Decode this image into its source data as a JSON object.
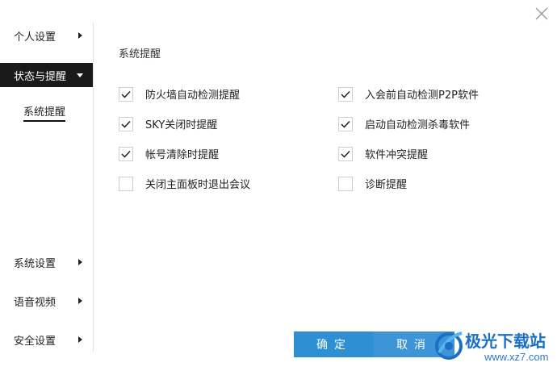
{
  "sidebar": {
    "items": [
      {
        "label": "个人设置"
      },
      {
        "label": "状态与提醒"
      },
      {
        "label": "系统设置"
      },
      {
        "label": "语音视频"
      },
      {
        "label": "安全设置"
      }
    ],
    "sub_item": "系统提醒"
  },
  "main": {
    "section_title": "系统提醒",
    "options": [
      {
        "label": "防火墙自动检测提醒",
        "checked": true
      },
      {
        "label": "入会前自动检测P2P软件",
        "checked": true
      },
      {
        "label": "SKY关闭时提醒",
        "checked": true
      },
      {
        "label": "启动自动检测杀毒软件",
        "checked": true
      },
      {
        "label": "帐号清除时提醒",
        "checked": true
      },
      {
        "label": "软件冲突提醒",
        "checked": true
      },
      {
        "label": "关闭主面板时退出会议",
        "checked": false
      },
      {
        "label": "诊断提醒",
        "checked": false
      }
    ]
  },
  "buttons": {
    "ok": "确定",
    "cancel": "取消"
  },
  "watermark": {
    "title": "极光下载站",
    "url": "www.xz7.com"
  },
  "colors": {
    "primary_button": "#2e8fd2",
    "active_nav": "#1a1a1a"
  }
}
